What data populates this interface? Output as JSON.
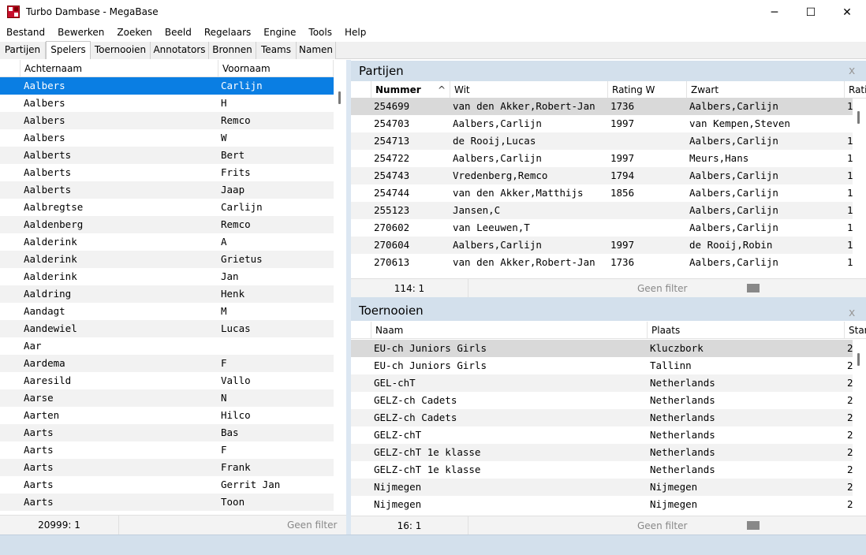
{
  "window": {
    "title": "Turbo Dambase - MegaBase",
    "minimize": "─",
    "maximize": "☐",
    "close": "✕"
  },
  "menu": [
    "Bestand",
    "Bewerken",
    "Zoeken",
    "Beeld",
    "Regelaars",
    "Engine",
    "Tools",
    "Help"
  ],
  "tabs": [
    "Partijen",
    "Spelers",
    "Toernooien",
    "Annotators",
    "Bronnen",
    "Teams",
    "Namen"
  ],
  "active_tab": "Spelers",
  "players": {
    "columns": [
      "Achternaam",
      "Voornaam"
    ],
    "rows": [
      [
        "Aalbers",
        "Carlijn"
      ],
      [
        "Aalbers",
        "H"
      ],
      [
        "Aalbers",
        "Remco"
      ],
      [
        "Aalbers",
        "W"
      ],
      [
        "Aalberts",
        "Bert"
      ],
      [
        "Aalberts",
        "Frits"
      ],
      [
        "Aalberts",
        "Jaap"
      ],
      [
        "Aalbregtse",
        "Carlijn"
      ],
      [
        "Aaldenberg",
        "Remco"
      ],
      [
        "Aalderink",
        "A"
      ],
      [
        "Aalderink",
        "Grietus"
      ],
      [
        "Aalderink",
        "Jan"
      ],
      [
        "Aaldring",
        "Henk"
      ],
      [
        "Aandagt",
        "M"
      ],
      [
        "Aandewiel",
        "Lucas"
      ],
      [
        "Aar",
        ""
      ],
      [
        "Aardema",
        "F"
      ],
      [
        "Aaresild",
        "Vallo"
      ],
      [
        "Aarse",
        "N"
      ],
      [
        "Aarten",
        "Hilco"
      ],
      [
        "Aarts",
        "Bas"
      ],
      [
        "Aarts",
        "F"
      ],
      [
        "Aarts",
        "Frank"
      ],
      [
        "Aarts",
        "Gerrit Jan"
      ],
      [
        "Aarts",
        "Toon"
      ]
    ],
    "status_count": "20999: 1",
    "status_filter": "Geen filter"
  },
  "games_panel": {
    "title": "Partijen",
    "close": "x",
    "columns": [
      "Nummer",
      "Wit",
      "Rating W",
      "Zwart",
      "Rati"
    ],
    "sort_indicator": "^",
    "rows": [
      [
        "254699",
        "van den Akker,Robert-Jan",
        "1736",
        "Aalbers,Carlijn",
        "1"
      ],
      [
        "254703",
        "Aalbers,Carlijn",
        "1997",
        "van Kempen,Steven",
        ""
      ],
      [
        "254713",
        "de Rooij,Lucas",
        "",
        "Aalbers,Carlijn",
        "1"
      ],
      [
        "254722",
        "Aalbers,Carlijn",
        "1997",
        "Meurs,Hans",
        "1"
      ],
      [
        "254743",
        "Vredenberg,Remco",
        "1794",
        "Aalbers,Carlijn",
        "1"
      ],
      [
        "254744",
        "van den Akker,Matthijs",
        "1856",
        "Aalbers,Carlijn",
        "1"
      ],
      [
        "255123",
        "Jansen,C",
        "",
        "Aalbers,Carlijn",
        "1"
      ],
      [
        "270602",
        "van Leeuwen,T",
        "",
        "Aalbers,Carlijn",
        "1"
      ],
      [
        "270604",
        "Aalbers,Carlijn",
        "1997",
        "de Rooij,Robin",
        "1"
      ],
      [
        "270613",
        "van den Akker,Robert-Jan",
        "1736",
        "Aalbers,Carlijn",
        "1"
      ]
    ],
    "status_count": "114: 1",
    "status_filter": "Geen filter"
  },
  "tournaments_panel": {
    "title": "Toernooien",
    "close": "x",
    "columns": [
      "Naam",
      "Plaats",
      "Star"
    ],
    "rows": [
      [
        "EU-ch Juniors Girls",
        "Kluczbork",
        "2"
      ],
      [
        "EU-ch Juniors Girls",
        "Tallinn",
        "2"
      ],
      [
        "GEL-chT",
        "Netherlands",
        "2"
      ],
      [
        "GELZ-ch Cadets",
        "Netherlands",
        "2"
      ],
      [
        "GELZ-ch Cadets",
        "Netherlands",
        "2"
      ],
      [
        "GELZ-chT",
        "Netherlands",
        "2"
      ],
      [
        "GELZ-chT 1e klasse",
        "Netherlands",
        "2"
      ],
      [
        "GELZ-chT 1e klasse",
        "Netherlands",
        "2"
      ],
      [
        "Nijmegen",
        "Nijmegen",
        "2"
      ],
      [
        "Nijmegen",
        "Nijmegen",
        "2"
      ]
    ],
    "status_count": "16: 1",
    "status_filter": "Geen filter"
  },
  "colors": {
    "selection": "#0a7ee3",
    "panel_header": "#d3e0ec",
    "highlight_row": "#d9d9d9",
    "alt_row": "#f2f2f2"
  }
}
